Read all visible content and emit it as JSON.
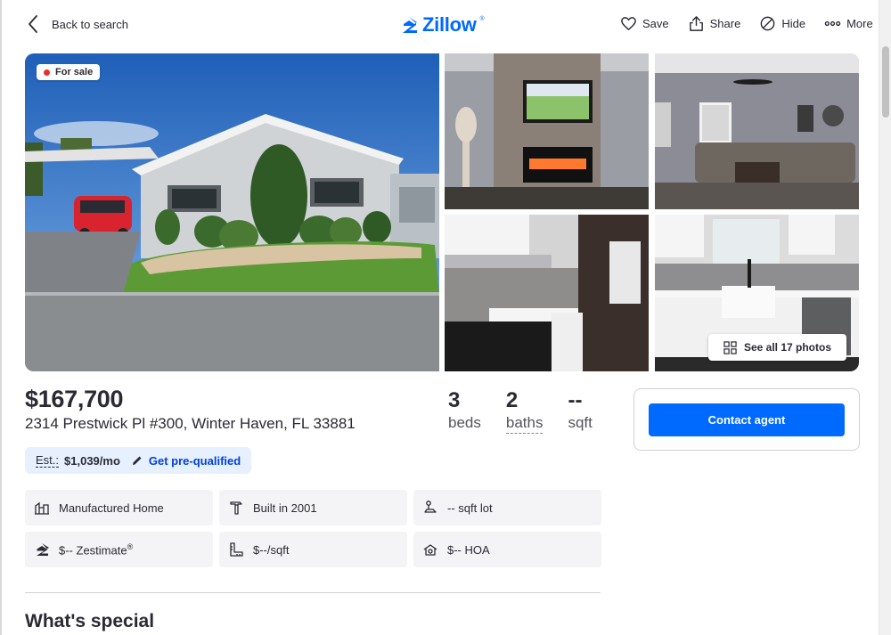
{
  "header": {
    "back_label": "Back to search",
    "logo_text": "Zillow",
    "logo_reg": "®",
    "actions": [
      {
        "label": "Save",
        "icon": "heart-icon"
      },
      {
        "label": "Share",
        "icon": "share-icon"
      },
      {
        "label": "Hide",
        "icon": "hide-icon"
      },
      {
        "label": "More",
        "icon": "more-icon"
      }
    ]
  },
  "gallery": {
    "badge": "For sale",
    "see_all_label": "See all 17 photos"
  },
  "listing": {
    "price": "$167,700",
    "address": "2314 Prestwick Pl #300, Winter Haven, FL 33881",
    "stats": [
      {
        "value": "3",
        "label": "beds"
      },
      {
        "value": "2",
        "label": "baths"
      },
      {
        "value": "--",
        "label": "sqft"
      }
    ],
    "estimate": {
      "label": "Est.:",
      "value": "$1,039/mo",
      "link": "Get pre-qualified"
    }
  },
  "facts": [
    {
      "text": "Manufactured Home",
      "icon": "home-type-icon"
    },
    {
      "text": "Built in 2001",
      "icon": "hammer-icon"
    },
    {
      "text": "-- sqft lot",
      "icon": "lot-icon"
    },
    {
      "text": "$-- Zestimate",
      "sup": "®",
      "icon": "zestimate-icon"
    },
    {
      "text": "$--/sqft",
      "icon": "ruler-icon"
    },
    {
      "text": "$-- HOA",
      "icon": "hoa-icon"
    }
  ],
  "section_title": "What's special",
  "contact": {
    "button_label": "Contact agent"
  },
  "colors": {
    "brand": "#006aff",
    "link": "#0041d9",
    "for_sale_dot": "#e52e2e"
  }
}
